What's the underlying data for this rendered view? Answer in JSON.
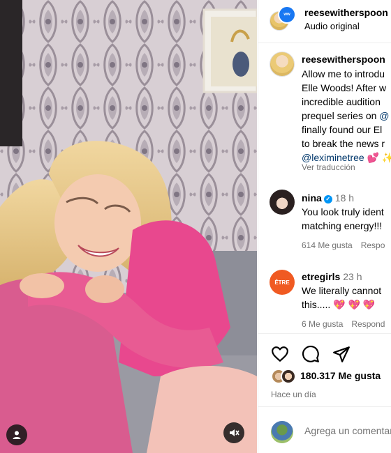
{
  "post": {
    "author": "reesewitherspoon",
    "audio": "Audio original",
    "badge_text": "ww"
  },
  "caption": {
    "author": "reesewitherspoon",
    "lines": [
      "Allow me to introdu",
      "Elle Woods! After w",
      "incredible audition",
      "prequel series on ",
      "finally found our El",
      "to break the news r"
    ],
    "prequel_mention": "@",
    "mention": "@leximinetree",
    "mention_suffix": " 💕 ✨",
    "translate": "Ver traducción"
  },
  "comments": [
    {
      "user": "nina",
      "verified": true,
      "time": "18 h",
      "lines": [
        "You look truly ident",
        "matching energy!!!"
      ],
      "likes": "614 Me gusta",
      "reply": "Respo"
    },
    {
      "user": "etregirls",
      "verified": false,
      "time": "23 h",
      "lines": [
        "We literally cannot",
        "this..... 💖 💖 💖"
      ],
      "likes": "6 Me gusta",
      "reply": "Respond",
      "avatar_text": "ÊTRE"
    }
  ],
  "actions": {
    "likes_count": "180.317 Me gusta",
    "date": "Hace un día"
  },
  "composer": {
    "placeholder": "Agrega un comentar"
  },
  "colors": {
    "accent_blue": "#0095f6",
    "mention_blue": "#00376b",
    "muted_gray": "#737373",
    "shirt_pink": "#e8488e",
    "etre_orange": "#f05a22"
  },
  "icons": [
    "user-icon",
    "mute-icon",
    "heart-icon",
    "comment-icon",
    "share-icon"
  ]
}
